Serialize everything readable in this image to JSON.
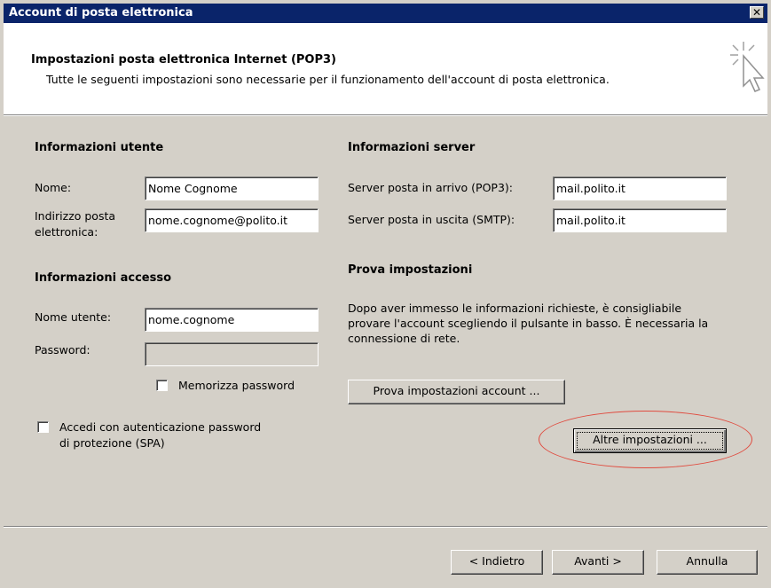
{
  "window": {
    "title": "Account di posta elettronica",
    "close_glyph": "✕"
  },
  "header": {
    "title": "Impostazioni posta elettronica Internet (POP3)",
    "description": "Tutte le seguenti impostazioni sono necessarie per il funzionamento dell'account di posta elettronica."
  },
  "user_info": {
    "heading": "Informazioni utente",
    "name_label": "Nome:",
    "name_value": "Nome Cognome",
    "email_label_line1": "Indirizzo posta",
    "email_label_line2": "elettronica:",
    "email_value": "nome.cognome@polito.it"
  },
  "access_info": {
    "heading": "Informazioni accesso",
    "username_label": "Nome utente:",
    "username_value": "nome.cognome",
    "password_label": "Password:",
    "password_value": "",
    "remember_label": "Memorizza password",
    "spa_label_line1": "Accedi con autenticazione password",
    "spa_label_line2": "di protezione (SPA)"
  },
  "server_info": {
    "heading": "Informazioni server",
    "incoming_label": "Server posta in arrivo (POP3):",
    "incoming_value": "mail.polito.it",
    "outgoing_label": "Server posta in uscita (SMTP):",
    "outgoing_value": "mail.polito.it"
  },
  "test": {
    "heading": "Prova impostazioni",
    "description": "Dopo aver immesso le informazioni richieste, è consigliabile provare l'account scegliendo il pulsante in basso. È necessaria la connessione di rete.",
    "test_button": "Prova impostazioni account ...",
    "more_button": "Altre impostazioni ..."
  },
  "footer": {
    "back_button": "< Indietro",
    "next_button": "Avanti >",
    "cancel_button": "Annulla"
  },
  "colors": {
    "titlebar": "#0a246a",
    "dialog": "#d4d0c8",
    "highlight_ellipse": "#e04b3f"
  },
  "icons": {
    "header": "cursor-click-icon",
    "close": "close-icon"
  }
}
